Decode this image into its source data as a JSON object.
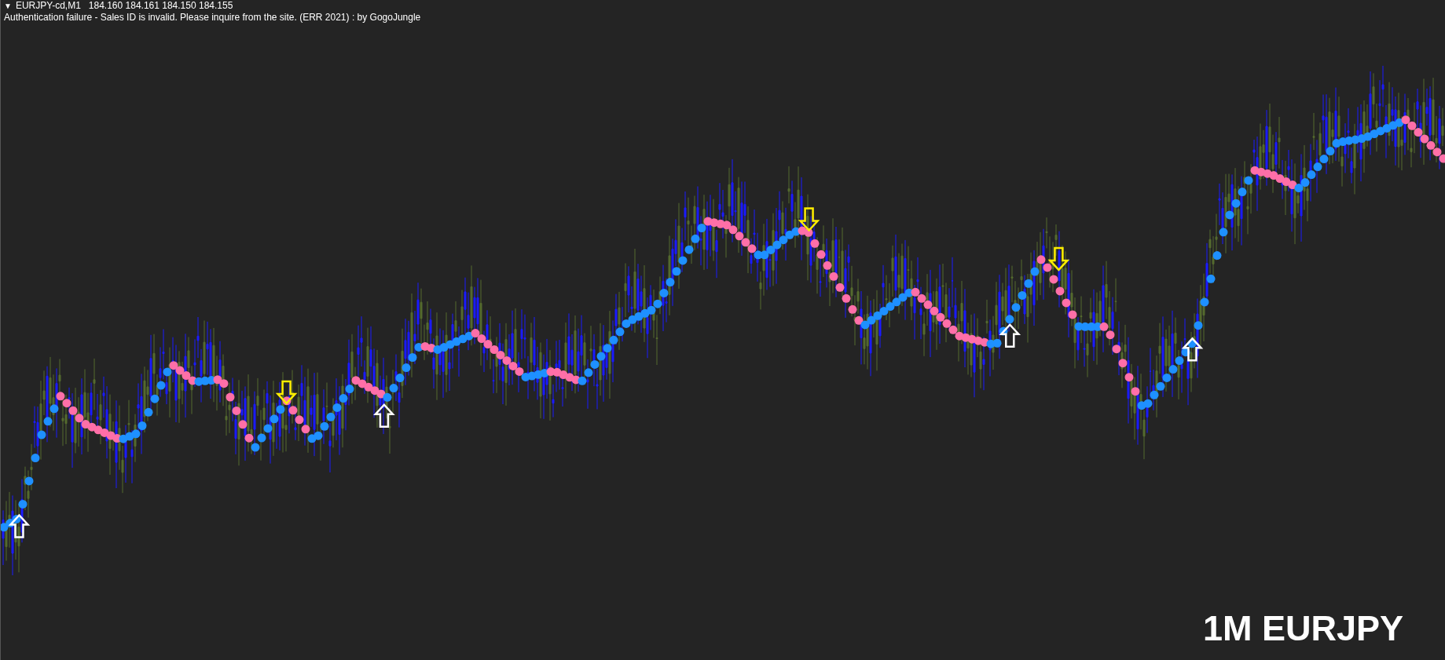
{
  "header": {
    "toggle": "▼",
    "symbol": "EURJPY-cd,M1",
    "quotes": "184.160 184.161 184.150 184.155",
    "message": "Authentication failure - Sales ID is invalid. Please inquire from the site. (ERR 2021) : by GogoJungle"
  },
  "signals": [
    {
      "kind": "up"
    },
    {
      "kind": "down"
    },
    {
      "kind": "up"
    },
    {
      "kind": "down"
    },
    {
      "kind": "up"
    },
    {
      "kind": "down"
    },
    {
      "kind": "up"
    }
  ],
  "caption": "1M EURJPY"
}
